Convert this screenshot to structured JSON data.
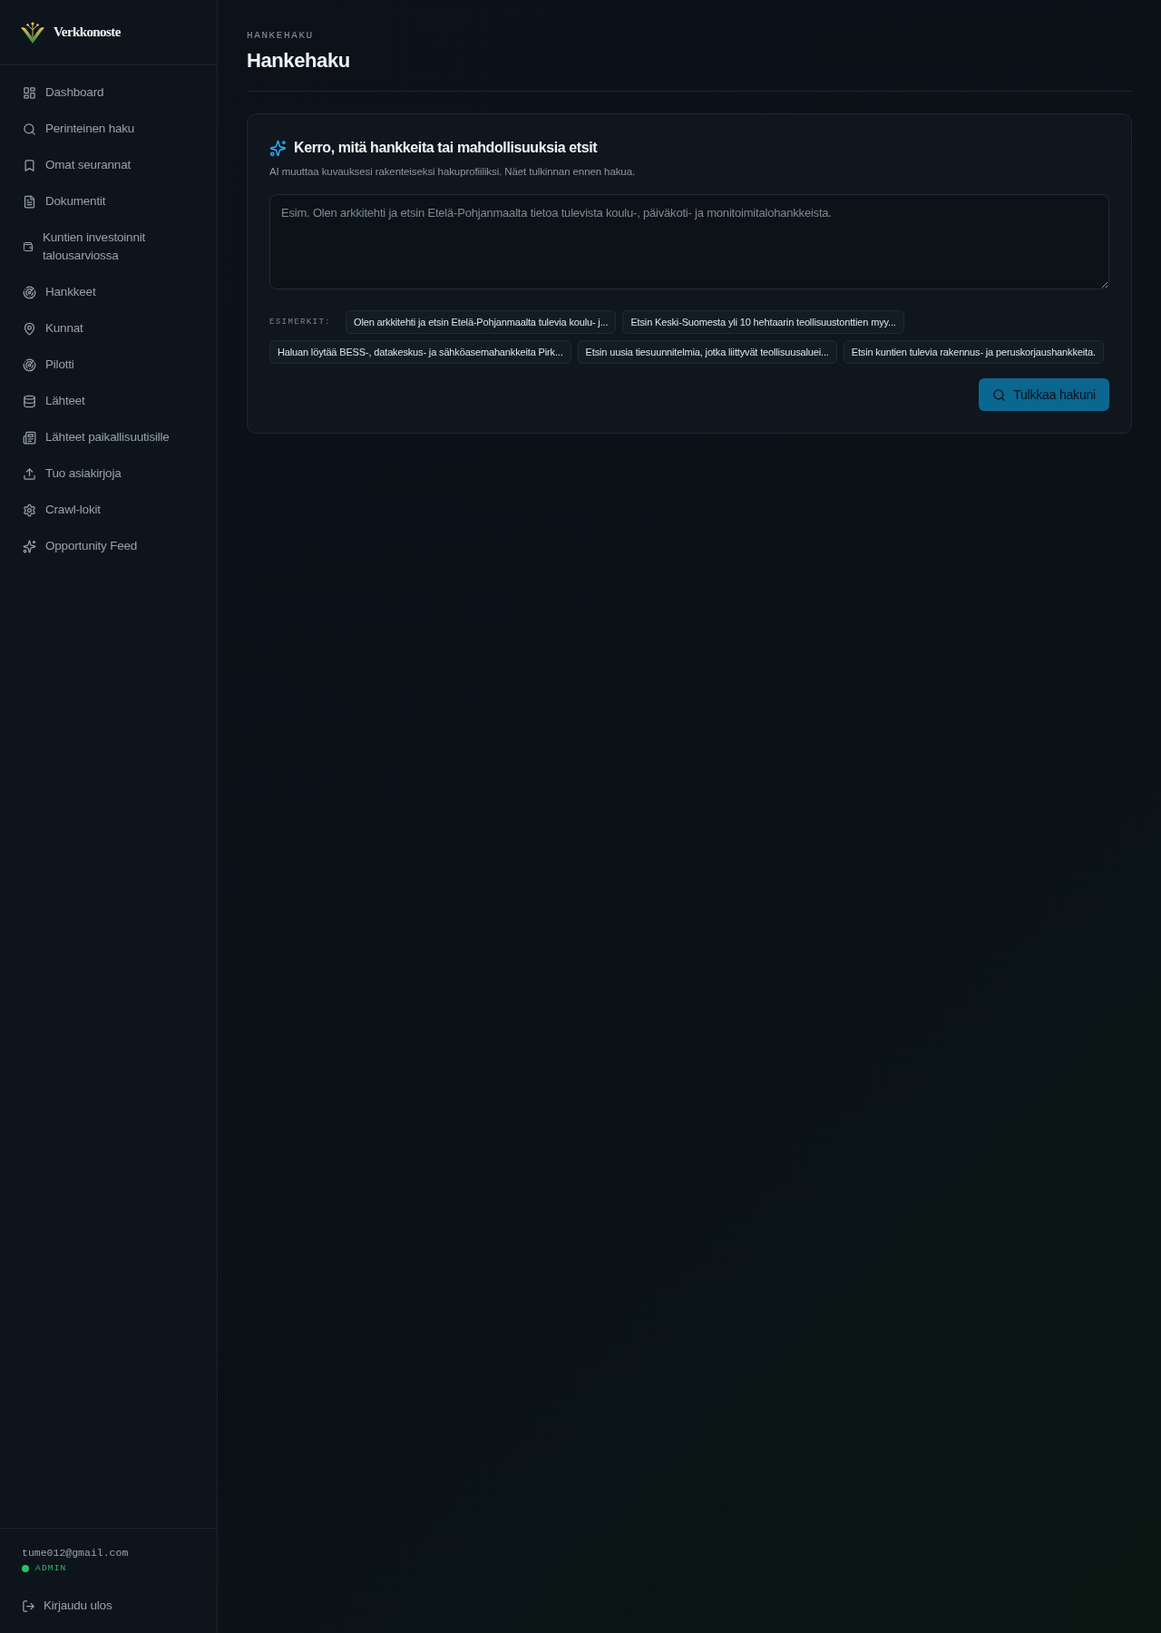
{
  "sidebar": {
    "brand": "Verkkonoste",
    "nav": [
      {
        "label": "Dashboard",
        "selected": false
      },
      {
        "label": "Perinteinen haku",
        "selected": false
      },
      {
        "label": "Omat seurannat",
        "selected": false
      },
      {
        "label": "Dokumentit",
        "selected": false
      },
      {
        "label": "Kuntien investoinnit talousarviossa",
        "selected": false
      },
      {
        "label": "Hankkeet",
        "selected": false
      },
      {
        "label": "Kunnat",
        "selected": false
      },
      {
        "label": "Pilotti",
        "selected": false
      },
      {
        "label": "Lähteet",
        "selected": false
      },
      {
        "label": "Lähteet paikallisuutisille",
        "selected": false
      },
      {
        "label": "Tuo asiakirjoja",
        "selected": false
      },
      {
        "label": "Crawl-lokit",
        "selected": false
      },
      {
        "label": "Opportunity Feed",
        "selected": false
      }
    ],
    "user": {
      "email": "tume012@gmail.com",
      "role": "ADMIN"
    },
    "logout": "Kirjaudu ulos"
  },
  "page": {
    "eyebrow": "HANKEHAKU",
    "title": "Hankehaku"
  },
  "search_card": {
    "title": "Kerro, mitä hankkeita tai mahdollisuuksia etsit",
    "subtitle": "AI muuttaa kuvauksesi rakenteiseksi hakuprofiiliksi. Näet tulkinnan ennen hakua.",
    "description": {
      "placeholder": "Esim. Olen arkkitehti ja etsin Etelä-Pohjanmaalta tietoa tulevista koulu-, päiväkoti- ja monitoimitalohankkeista."
    },
    "examples_label": "ESIMERKIT:",
    "examples": [
      "Olen arkkitehti ja etsin Etelä-Pohjanmaalta tulevia koulu- j...",
      "Etsin Keski-Suomesta yli 10 hehtaarin teollisuustonttien myy...",
      "Haluan löytää BESS-, datakeskus- ja sähköasemahankkeita Pirk...",
      "Etsin uusia tiesuunnitelmia, jotka liittyvät teollisuusaluei...",
      "Etsin kuntien tulevia rakennus- ja peruskorjaushankkeita."
    ],
    "submit": "Tulkkaa hakuni"
  }
}
